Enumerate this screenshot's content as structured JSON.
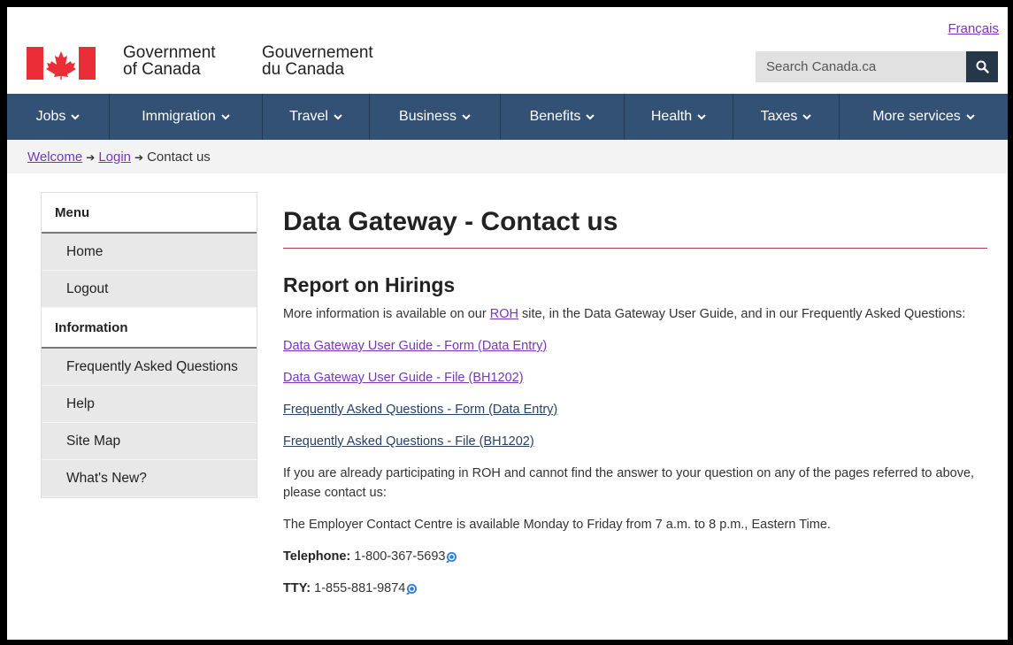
{
  "header": {
    "language_link": "Français",
    "signature_en_line1": "Government",
    "signature_en_line2": "of Canada",
    "signature_fr_line1": "Gouvernement",
    "signature_fr_line2": "du Canada",
    "search_placeholder": "Search Canada.ca",
    "flag_color": "#eb2d37",
    "search_button_icon": "search-icon"
  },
  "nav": {
    "items": [
      {
        "label": "Jobs"
      },
      {
        "label": "Immigration"
      },
      {
        "label": "Travel"
      },
      {
        "label": "Business"
      },
      {
        "label": "Benefits"
      },
      {
        "label": "Health"
      },
      {
        "label": "Taxes"
      },
      {
        "label": "More services"
      }
    ],
    "background": "#335075"
  },
  "breadcrumb": {
    "items": [
      "Welcome",
      "Login"
    ],
    "current": "Contact us"
  },
  "sidebar": {
    "menu_heading": "Menu",
    "menu_items": [
      "Home",
      "Logout"
    ],
    "info_heading": "Information",
    "info_items": [
      "Frequently Asked Questions",
      "Help",
      "Site Map",
      "What's New?"
    ]
  },
  "main": {
    "title": "Data Gateway - Contact us",
    "section_title": "Report on Hirings",
    "intro_before": "More information is available on our ",
    "intro_link": "ROH",
    "intro_after": " site, in the Data Gateway User Guide, and in our Frequently Asked Questions:",
    "links": [
      "Data Gateway User Guide - Form (Data Entry)",
      "Data Gateway User Guide - File (BH1202)",
      "Frequently Asked Questions - Form (Data Entry)",
      "Frequently Asked Questions - File (BH1202)"
    ],
    "contact_intro": "If you are already participating in ROH and cannot find the answer to your question on any of the pages referred to above, please contact us:",
    "hours": "The Employer Contact Centre is available Monday to Friday from 7 a.m. to 8 p.m., Eastern Time.",
    "telephone_label": "Telephone:",
    "telephone_number": "1-800-367-5693",
    "tty_label": "TTY:",
    "tty_number": "1-855-881-9874",
    "phone_icon": "phone-call-icon"
  }
}
